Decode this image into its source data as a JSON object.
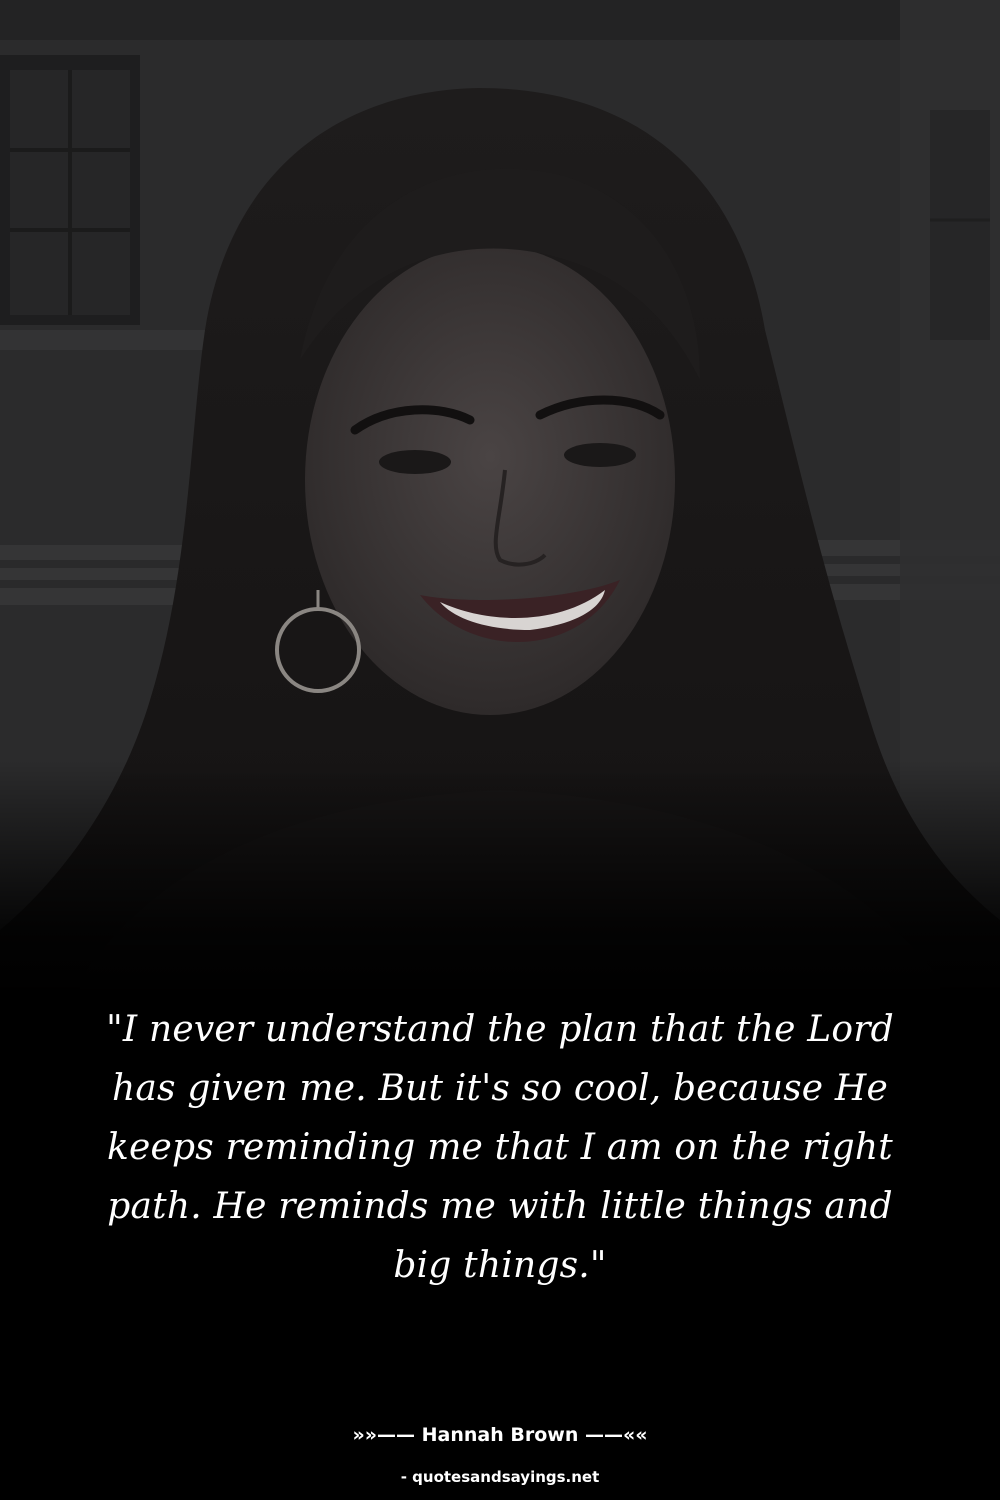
{
  "quote": {
    "text": "\"I never understand the plan that the Lord has given me. But it's so cool, because He keeps reminding me that I am on the right path. He reminds me with little things and big things.\""
  },
  "author": {
    "line": "»»—— Hannah Brown ——««"
  },
  "source": {
    "site": "- quotesandsayings.net"
  },
  "colors": {
    "background": "#000000",
    "text": "#ffffff",
    "photo_tint": "#2a2a2a"
  }
}
